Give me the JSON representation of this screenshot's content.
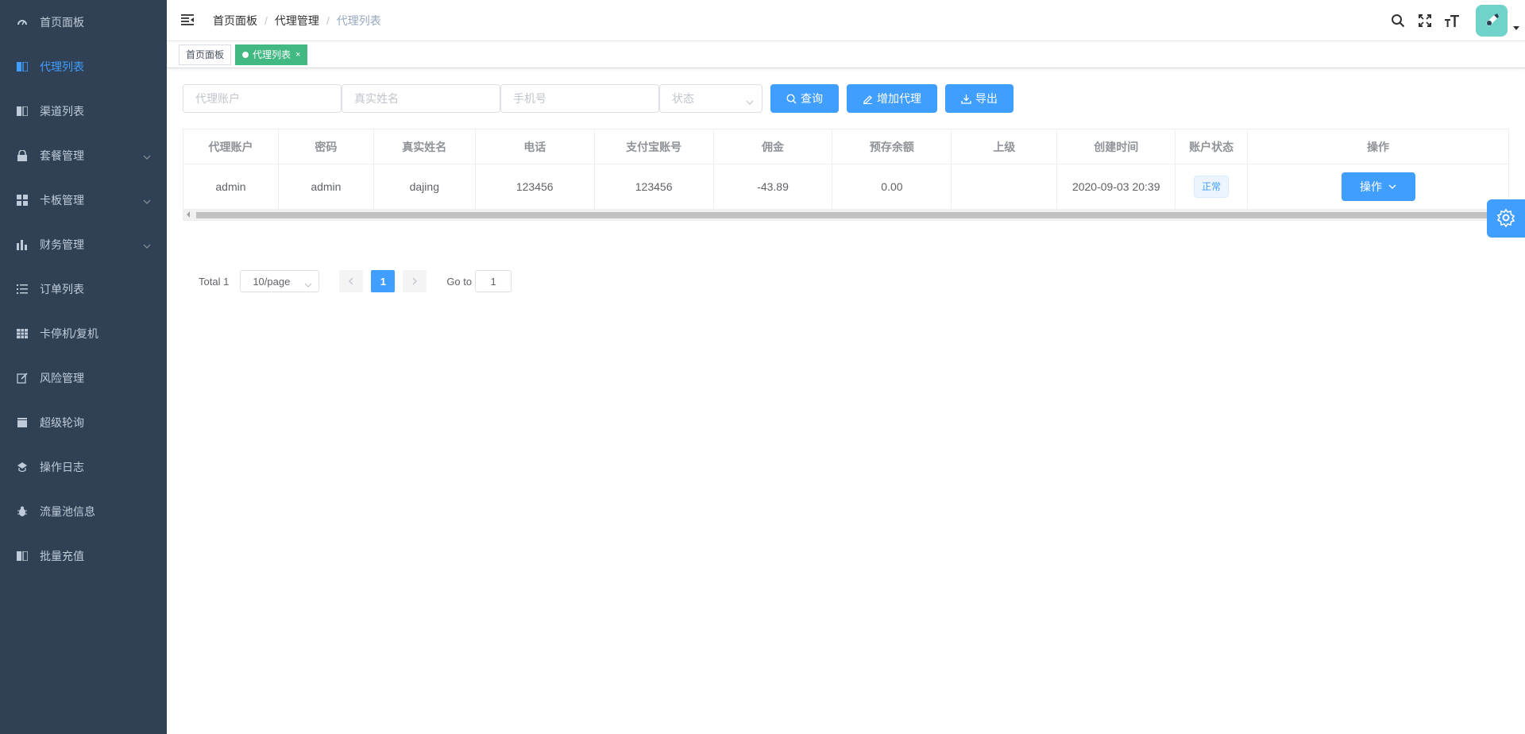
{
  "sidebar": {
    "items": [
      {
        "label": "首页面板",
        "icon": "dashboard-icon"
      },
      {
        "label": "代理列表",
        "icon": "book-icon",
        "active": true
      },
      {
        "label": "渠道列表",
        "icon": "book-icon"
      },
      {
        "label": "套餐管理",
        "icon": "lock-icon",
        "expandable": true
      },
      {
        "label": "卡板管理",
        "icon": "grid-icon",
        "expandable": true
      },
      {
        "label": "财务管理",
        "icon": "bar-chart-icon",
        "expandable": true
      },
      {
        "label": "订单列表",
        "icon": "list-icon"
      },
      {
        "label": "卡停机/复机",
        "icon": "table-icon"
      },
      {
        "label": "风险管理",
        "icon": "edit-icon"
      },
      {
        "label": "超级轮询",
        "icon": "clapper-icon"
      },
      {
        "label": "操作日志",
        "icon": "guide-icon"
      },
      {
        "label": "流量池信息",
        "icon": "bug-icon"
      },
      {
        "label": "批量充值",
        "icon": "book-icon"
      }
    ]
  },
  "breadcrumb": [
    "首页面板",
    "代理管理",
    "代理列表"
  ],
  "tags": [
    {
      "label": "首页面板",
      "active": false
    },
    {
      "label": "代理列表",
      "active": true,
      "close": "×"
    }
  ],
  "filter": {
    "account_placeholder": "代理账户",
    "realname_placeholder": "真实姓名",
    "phone_placeholder": "手机号",
    "status_placeholder": "状态",
    "query_label": "查询",
    "add_label": "增加代理",
    "export_label": "导出"
  },
  "table": {
    "headers": [
      "代理账户",
      "密码",
      "真实姓名",
      "电话",
      "支付宝账号",
      "佣金",
      "预存余额",
      "上级",
      "创建时间",
      "账户状态",
      "操作"
    ],
    "rows": [
      {
        "account": "admin",
        "password": "admin",
        "realname": "dajing",
        "phone": "123456",
        "alipay": "123456",
        "commission": "-43.89",
        "balance": "0.00",
        "parent": "",
        "created": "2020-09-03 20:39",
        "status": "正常",
        "action": "操作"
      }
    ]
  },
  "pagination": {
    "total": "Total 1",
    "page_size": "10/page",
    "current": "1",
    "goto_label": "Go to",
    "goto_value": "1"
  },
  "colors": {
    "sidebar_bg": "#304156",
    "primary": "#409eff",
    "tag_active": "#42b983"
  }
}
